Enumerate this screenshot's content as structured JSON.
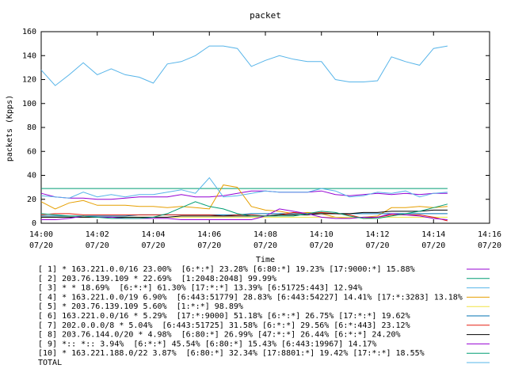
{
  "chart_data": {
    "type": "line",
    "title": "packet",
    "xlabel": "Time",
    "ylabel": "packets (Kpps)",
    "ylim": [
      0,
      160
    ],
    "yticks": [
      0,
      20,
      40,
      60,
      80,
      100,
      120,
      140,
      160
    ],
    "xlim": [
      "2024-07-20T14:00",
      "2024-07-20T14:16"
    ],
    "xtick_labels": [
      {
        "time": "14:00",
        "date": "07/20"
      },
      {
        "time": "14:02",
        "date": "07/20"
      },
      {
        "time": "14:04",
        "date": "07/20"
      },
      {
        "time": "14:06",
        "date": "07/20"
      },
      {
        "time": "14:08",
        "date": "07/20"
      },
      {
        "time": "14:10",
        "date": "07/20"
      },
      {
        "time": "14:12",
        "date": "07/20"
      },
      {
        "time": "14:14",
        "date": "07/20"
      },
      {
        "time": "14:16",
        "date": "07/20"
      }
    ],
    "grid": false,
    "legend_position": "bottom",
    "x": [
      "14:00",
      "14:00:30",
      "14:01",
      "14:01:30",
      "14:02",
      "14:02:30",
      "14:03",
      "14:03:30",
      "14:04",
      "14:04:30",
      "14:05",
      "14:05:30",
      "14:06",
      "14:06:30",
      "14:07",
      "14:07:30",
      "14:08",
      "14:08:30",
      "14:09",
      "14:09:30",
      "14:10",
      "14:10:30",
      "14:11",
      "14:11:30",
      "14:12",
      "14:12:30",
      "14:13",
      "14:13:30",
      "14:14",
      "14:14:30"
    ],
    "series": [
      {
        "name": "[ 1] * 163.221.0.0/16 23.00%  [6:*:*] 23.28% [6:80:*] 19.23% [17:9000:*] 15.88%",
        "color": "#9400d3",
        "values": [
          25,
          22,
          21,
          21,
          20,
          20,
          21,
          22,
          22,
          22,
          24,
          22,
          22,
          23,
          25,
          27,
          27,
          26,
          26,
          26,
          27,
          24,
          23,
          24,
          25,
          24,
          25,
          24,
          25,
          25
        ]
      },
      {
        "name": "[ 2] 203.76.139.109 * 22.69%  [1:2048:2048] 99.99%",
        "color": "#009e73",
        "values": [
          29,
          29,
          29,
          29,
          29,
          29,
          29,
          29,
          29,
          29,
          29,
          29,
          29,
          29,
          29,
          29,
          29,
          29,
          29,
          29,
          29,
          29,
          29,
          29,
          29,
          29,
          29,
          29,
          29,
          29
        ]
      },
      {
        "name": "[ 3] * * 18.69%  [6:*:*] 61.30% [17:*:*] 13.39% [6:51725:443] 12.94%",
        "color": "#56b4e9",
        "values": [
          128,
          115,
          124,
          134,
          124,
          129,
          124,
          122,
          117,
          133,
          135,
          140,
          148,
          148,
          146,
          131,
          136,
          140,
          137,
          135,
          135,
          120,
          118,
          118,
          119,
          139,
          135,
          132,
          146,
          148
        ]
      },
      {
        "name": "[ 4] * 163.221.0.0/19 6.90%  [6:443:51779] 28.83% [6:443:54227] 14.41% [17:*:3283] 13.18%",
        "color": "#e69f00",
        "values": [
          18,
          12,
          17,
          19,
          15,
          15,
          15,
          14,
          14,
          13,
          14,
          13,
          12,
          32,
          30,
          14,
          11,
          10,
          8,
          9,
          8,
          5,
          4,
          5,
          6,
          13,
          13,
          14,
          13,
          14
        ]
      },
      {
        "name": "[ 5] * 203.76.139.109 5.60%  [1:*:*] 98.89%",
        "color": "#f0e442",
        "values": [
          5,
          5,
          5,
          5,
          5,
          5,
          5,
          5,
          5,
          5,
          5,
          5,
          5,
          5,
          5,
          5,
          5,
          5,
          5,
          5,
          5,
          5,
          5,
          5,
          5,
          5,
          5,
          5,
          5,
          5
        ]
      },
      {
        "name": "[ 6] 163.221.0.0/16 * 5.29%  [17:*:9000] 51.18% [6:*:*] 26.75% [17:*:*] 19.62%",
        "color": "#0072b2",
        "values": [
          6,
          6,
          6,
          6,
          6,
          6,
          6,
          7,
          7,
          7,
          7,
          7,
          7,
          7,
          7,
          8,
          8,
          8,
          8,
          8,
          8,
          8,
          8,
          8,
          8,
          8,
          8,
          8,
          8,
          8
        ]
      },
      {
        "name": "[ 7] 202.0.0.0/8 * 5.04%  [6:443:51725] 31.58% [6:*:*] 29.56% [6:*:443] 23.12%",
        "color": "#e51e10",
        "values": [
          7,
          8,
          8,
          7,
          7,
          7,
          7,
          7,
          7,
          7,
          7,
          7,
          7,
          6,
          7,
          7,
          6,
          7,
          9,
          8,
          9,
          8,
          7,
          4,
          5,
          7,
          7,
          7,
          5,
          2
        ]
      },
      {
        "name": "[ 8] 203.76.144.0/20 * 4.98%  [6:80:*] 26.99% [47:*:*] 26.44% [6:*:*] 24.20%",
        "color": "#000000",
        "values": [
          5,
          5,
          5,
          5,
          5,
          5,
          5,
          5,
          5,
          5,
          6,
          6,
          6,
          6,
          6,
          6,
          6,
          7,
          7,
          7,
          8,
          8,
          8,
          9,
          9,
          10,
          10,
          10,
          11,
          11
        ]
      },
      {
        "name": "[ 9] *:: *:: 3.94%  [6:*:*] 45.54% [6:80:*] 15.43% [6:443:19967] 14.17%",
        "color": "#9400d3",
        "values": [
          3,
          3,
          4,
          6,
          5,
          5,
          4,
          4,
          4,
          4,
          3,
          3,
          3,
          3,
          3,
          3,
          6,
          12,
          10,
          8,
          5,
          4,
          4,
          5,
          5,
          8,
          7,
          6,
          4,
          3
        ]
      },
      {
        "name": "[10] * 163.221.188.0/22 3.87%  [6:80:*] 32.34% [17:8801:*] 19.42% [17:*:*] 18.55%",
        "color": "#009e73",
        "values": [
          8,
          7,
          6,
          6,
          5,
          4,
          4,
          4,
          5,
          8,
          13,
          18,
          14,
          12,
          8,
          6,
          6,
          6,
          6,
          8,
          10,
          9,
          6,
          4,
          4,
          6,
          8,
          10,
          13,
          16
        ]
      },
      {
        "name": "TOTAL",
        "color": "#56b4e9",
        "values": [
          23,
          22,
          21,
          26,
          22,
          24,
          22,
          24,
          24,
          26,
          28,
          25,
          38,
          22,
          23,
          25,
          27,
          26,
          26,
          26,
          29,
          27,
          22,
          23,
          26,
          25,
          27,
          22,
          25,
          26
        ]
      }
    ]
  }
}
